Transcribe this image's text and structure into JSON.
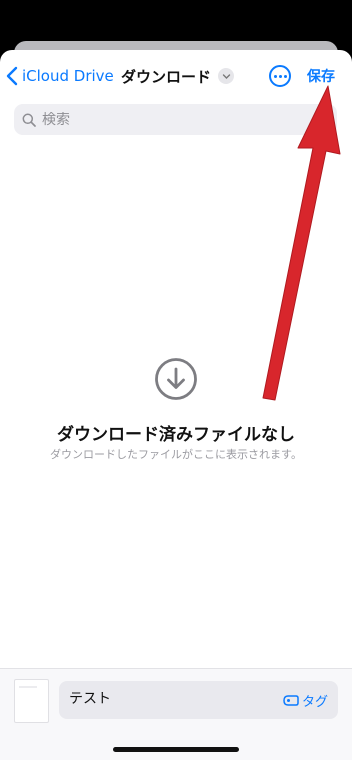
{
  "nav": {
    "back_label": "iCloud Drive",
    "title": "ダウンロード",
    "save_label": "保存"
  },
  "search": {
    "placeholder": "検索"
  },
  "empty_state": {
    "title": "ダウンロード済みファイルなし",
    "subtitle": "ダウンロードしたファイルがここに表示されます。"
  },
  "bottom": {
    "filename": "テスト",
    "tag_label": "タグ"
  },
  "colors": {
    "accent": "#0a7aff",
    "annotation_arrow": "#d8262c"
  },
  "icons": [
    "chevron-left-icon",
    "chevron-down-icon",
    "more-icon",
    "search-icon",
    "download-circle-icon",
    "tag-icon"
  ]
}
